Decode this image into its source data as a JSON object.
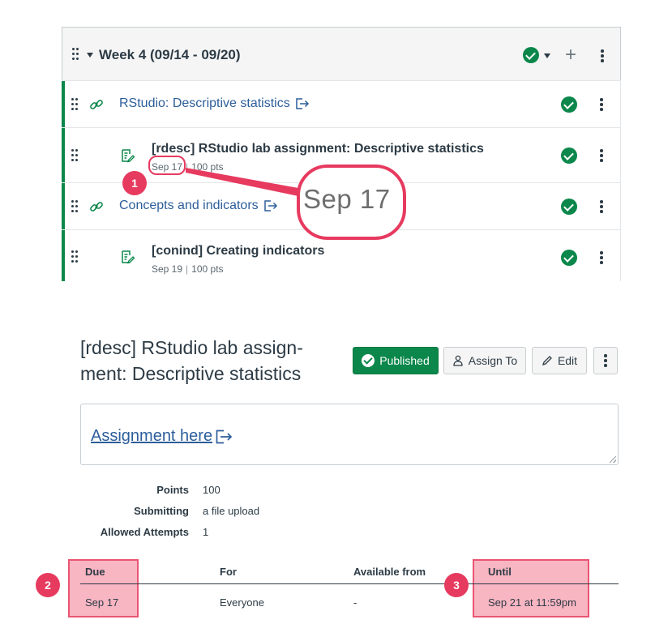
{
  "module": {
    "title": "Week 4 (09/14 - 09/20)",
    "items": [
      {
        "kind": "external_link",
        "title": "RStudio: Descriptive statistics"
      },
      {
        "kind": "assignment",
        "title": "[rdesc] RStudio lab assignment: Descriptive statistics",
        "due": "Sep 17",
        "points": "100 pts"
      },
      {
        "kind": "external_link",
        "title": "Concepts and indicators"
      },
      {
        "kind": "assignment",
        "title": "[conind] Creating indicators",
        "due": "Sep 19",
        "points": "100 pts"
      }
    ],
    "separator": "|"
  },
  "callouts": {
    "one": "1",
    "two": "2",
    "three": "3",
    "zoom_text": "Sep 17"
  },
  "assignment": {
    "title": "[rdesc] RStudio lab assign-ment: Descriptive statistics",
    "title_line1": "[rdesc] RStudio lab assign-",
    "title_line2": "ment: Descriptive statistics",
    "buttons": {
      "published": "Published",
      "assign_to": "Assign To",
      "edit": "Edit"
    },
    "description_link": "Assignment here",
    "details": [
      {
        "label": "Points",
        "value": "100"
      },
      {
        "label": "Submitting",
        "value": "a file upload"
      },
      {
        "label": "Allowed Attempts",
        "value": "1"
      }
    ],
    "dates_table": {
      "headers": [
        "Due",
        "For",
        "Available from",
        "Until"
      ],
      "row": [
        "Sep 17",
        "Everyone",
        "-",
        "Sep 21 at 11:59pm"
      ]
    }
  },
  "colors": {
    "success": "#0b874b",
    "link": "#2d5e9a",
    "callout": "#e73a5f",
    "text": "#2d3b45"
  }
}
